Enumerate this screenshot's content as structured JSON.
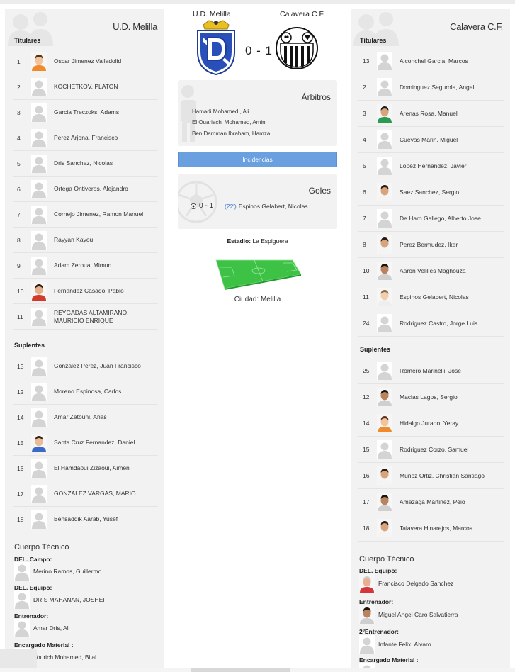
{
  "home": {
    "name": "U.D. Melilla",
    "titulares_label": "Titulares",
    "suplentes_label": "Suplentes",
    "titulares": [
      {
        "num": "1",
        "name": "Oscar Jimenez Valladolid",
        "photo": "face-orange"
      },
      {
        "num": "2",
        "name": "KOCHETKOV, PLATON",
        "photo": "generic"
      },
      {
        "num": "3",
        "name": "Garcia Treczoks, Adams",
        "photo": "generic"
      },
      {
        "num": "4",
        "name": "Perez Arjona, Francisco",
        "photo": "generic"
      },
      {
        "num": "5",
        "name": "Dris Sanchez, Nicolas",
        "photo": "generic"
      },
      {
        "num": "6",
        "name": "Ortega Ontiveros, Alejandro",
        "photo": "generic"
      },
      {
        "num": "7",
        "name": "Cornejo Jimenez, Ramon Manuel",
        "photo": "generic"
      },
      {
        "num": "8",
        "name": "Rayyan Kayou",
        "photo": "generic"
      },
      {
        "num": "9",
        "name": "Adam Zeroual Mimun",
        "photo": "generic"
      },
      {
        "num": "10",
        "name": "Fernandez Casado, Pablo",
        "photo": "face-red"
      },
      {
        "num": "11",
        "name": "REYGADAS ALTAMIRANO, MAURICIO ENRIQUE",
        "photo": "generic"
      }
    ],
    "suplentes": [
      {
        "num": "13",
        "name": "Gonzalez Perez, Juan Francisco",
        "photo": "generic"
      },
      {
        "num": "12",
        "name": "Moreno Espinosa, Carlos",
        "photo": "generic"
      },
      {
        "num": "14",
        "name": "Amar Zetouni, Anas",
        "photo": "generic"
      },
      {
        "num": "15",
        "name": "Santa Cruz Fernandez, Daniel",
        "photo": "face-blue"
      },
      {
        "num": "16",
        "name": "El Hamdaoui Zizaoui, Aimen",
        "photo": "generic"
      },
      {
        "num": "17",
        "name": "GONZALEZ VARGAS, MARIO",
        "photo": "generic"
      },
      {
        "num": "18",
        "name": "Bensaddik Aarab, Yusef",
        "photo": "generic"
      }
    ],
    "staff_title": "Cuerpo Técnico",
    "staff": [
      {
        "role": "DEL. Campo:",
        "name": "Merino Ramos, Guillermo"
      },
      {
        "role": "DEL. Equipo:",
        "name": "DRIS MAHANAN, JOSHEF"
      },
      {
        "role": "Entrenador:",
        "name": "Amar Dris, Ali"
      },
      {
        "role": "Encargado Material :",
        "name": "Yourich Mohamed, Bilal"
      }
    ]
  },
  "away": {
    "name": "Calavera C.F.",
    "titulares_label": "Titulares",
    "suplentes_label": "Suplentes",
    "titulares": [
      {
        "num": "13",
        "name": "Alconchel Garcia, Marcos",
        "photo": "generic"
      },
      {
        "num": "2",
        "name": "Dominguez Segurola, Angel",
        "photo": "generic"
      },
      {
        "num": "3",
        "name": "Arenas Rosa, Manuel",
        "photo": "face-green"
      },
      {
        "num": "4",
        "name": "Cuevas Marin, Miguel",
        "photo": "generic"
      },
      {
        "num": "5",
        "name": "Lopez Hernandez, Javier",
        "photo": "generic"
      },
      {
        "num": "6",
        "name": "Saez Sanchez, Sergio",
        "photo": "face-white"
      },
      {
        "num": "7",
        "name": "De Haro Gallego, Alberto Jose",
        "photo": "generic"
      },
      {
        "num": "8",
        "name": "Perez Bermudez, Iker",
        "photo": "face-white"
      },
      {
        "num": "10",
        "name": "Aaron Velilles Maghouza",
        "photo": "face-dark"
      },
      {
        "num": "11",
        "name": "Espinos Gelabert, Nicolas",
        "photo": "face-light"
      },
      {
        "num": "24",
        "name": "Rodriguez Castro, Jorge Luis",
        "photo": "generic"
      }
    ],
    "suplentes": [
      {
        "num": "25",
        "name": "Romero Marinelli, Jose",
        "photo": "generic"
      },
      {
        "num": "12",
        "name": "Macias Lagos, Sergio",
        "photo": "face-dark"
      },
      {
        "num": "14",
        "name": "Hidalgo Jurado, Yeray",
        "photo": "face-orange"
      },
      {
        "num": "15",
        "name": "Rodriguez Corzo, Samuel",
        "photo": "generic"
      },
      {
        "num": "16",
        "name": "Muñoz Ortiz, Christian Santiago",
        "photo": "face-white"
      },
      {
        "num": "17",
        "name": "Amezaga Martinez, Peio",
        "photo": "face-dark"
      },
      {
        "num": "18",
        "name": "Talavera Hinarejos, Marcos",
        "photo": "face-white"
      }
    ],
    "staff_title": "Cuerpo Técnico",
    "staff": [
      {
        "role": "DEL. Equipo:",
        "name": "Francisco Delgado Sanchez",
        "photo": "face-old"
      },
      {
        "role": "Entrenador:",
        "name": "Miguel Angel Caro Salvatierra",
        "photo": "face-dark"
      },
      {
        "role": "2ºEntrenador:",
        "name": "Infante Felix, Alvaro",
        "photo": "generic"
      },
      {
        "role": "Encargado Material :",
        "name": "",
        "photo": "generic"
      }
    ]
  },
  "match": {
    "home_name": "U.D. Melilla",
    "away_name": "Calavera C.F.",
    "score": "0 - 1",
    "referees_title": "Árbitros",
    "referees": [
      "Hamadi Mohamed , Ali",
      "El Ouariachi Mohamed, Amin",
      "Ben Damman Ibraham, Hamza"
    ],
    "incidencias_label": "Incidencias",
    "goals_title": "Goles",
    "goals": [
      {
        "score": "0 - 1",
        "minute": "(22')",
        "player": "Espinos Gelabert, Nicolas"
      }
    ],
    "stadium_label": "Estadio:",
    "stadium_name": "La Espiguera",
    "city_label": "Ciudad:",
    "city_name": "Melilla"
  },
  "colors": {
    "panel_bg": "#f2f2f2",
    "button_blue": "#6a9fe0",
    "link_blue": "#3a78c8",
    "pitch_green": "#3dc245"
  }
}
